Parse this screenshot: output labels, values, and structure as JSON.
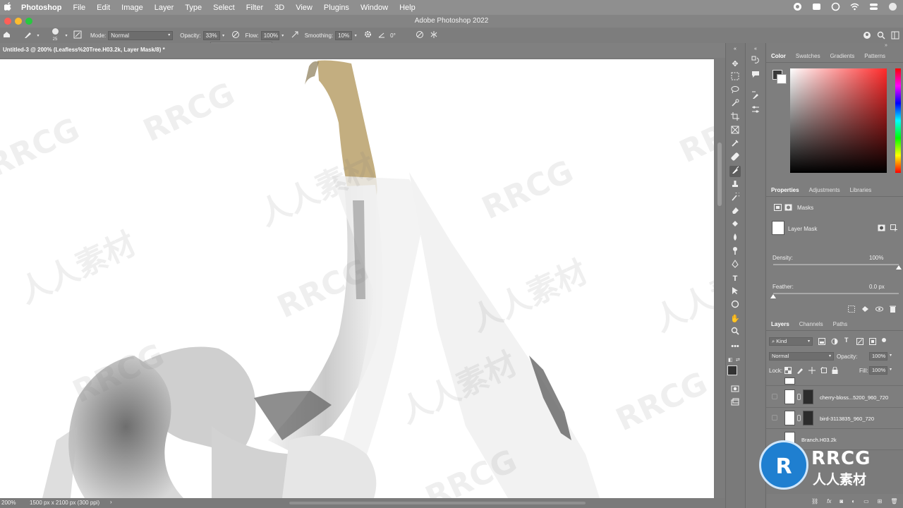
{
  "menubar": {
    "apple": "",
    "items": [
      "Photoshop",
      "File",
      "Edit",
      "Image",
      "Layer",
      "Type",
      "Select",
      "Filter",
      "3D",
      "View",
      "Plugins",
      "Window",
      "Help"
    ]
  },
  "window": {
    "title": "Adobe Photoshop 2022"
  },
  "options": {
    "brush_size": "25",
    "mode_label": "Mode:",
    "mode_value": "Normal",
    "opacity_label": "Opacity:",
    "opacity_value": "33%",
    "flow_label": "Flow:",
    "flow_value": "100%",
    "smoothing_label": "Smoothing:",
    "smoothing_value": "10%",
    "angle_value": "0°",
    "opacity_slider_level": 0.33
  },
  "document": {
    "tab_title": "Untitled-3 @ 200% (Leafless%20Tree.H03.2k, Layer Mask/8) *",
    "zoom": "200%",
    "doc_info": "1500 px x 2100 px (300 ppi)"
  },
  "watermarks": {
    "cn": "人人素材",
    "en": "RRCG"
  },
  "color_panel": {
    "tabs": [
      "Color",
      "Swatches",
      "Gradients",
      "Patterns"
    ],
    "active_tab": "Color"
  },
  "properties_panel": {
    "tabs": [
      "Properties",
      "Adjustments",
      "Libraries"
    ],
    "masks_label": "Masks",
    "layer_mask_label": "Layer Mask",
    "density_label": "Density:",
    "density_value": "100%",
    "density_level": 1.0,
    "feather_label": "Feather:",
    "feather_value": "0.0 px",
    "feather_level": 0.0
  },
  "layers_panel": {
    "tabs": [
      "Layers",
      "Channels",
      "Paths"
    ],
    "kind_label": "Kind",
    "blend_mode": "Normal",
    "opacity_label": "Opacity:",
    "opacity_value": "100%",
    "lock_label": "Lock:",
    "fill_label": "Fill:",
    "fill_value": "100%",
    "layers": [
      {
        "name": "cherry-bloss...5200_960_720"
      },
      {
        "name": "bird-3113835_960_720"
      },
      {
        "name": "Branch.H03.2k"
      }
    ]
  },
  "logo": {
    "top": "RRCG",
    "bottom": "人人素材"
  },
  "colors": {
    "menubar": "#8f8f8f",
    "canvas": "#ffffff",
    "brush_paint": "#b9a06a",
    "panel": "#7e7e7e"
  }
}
